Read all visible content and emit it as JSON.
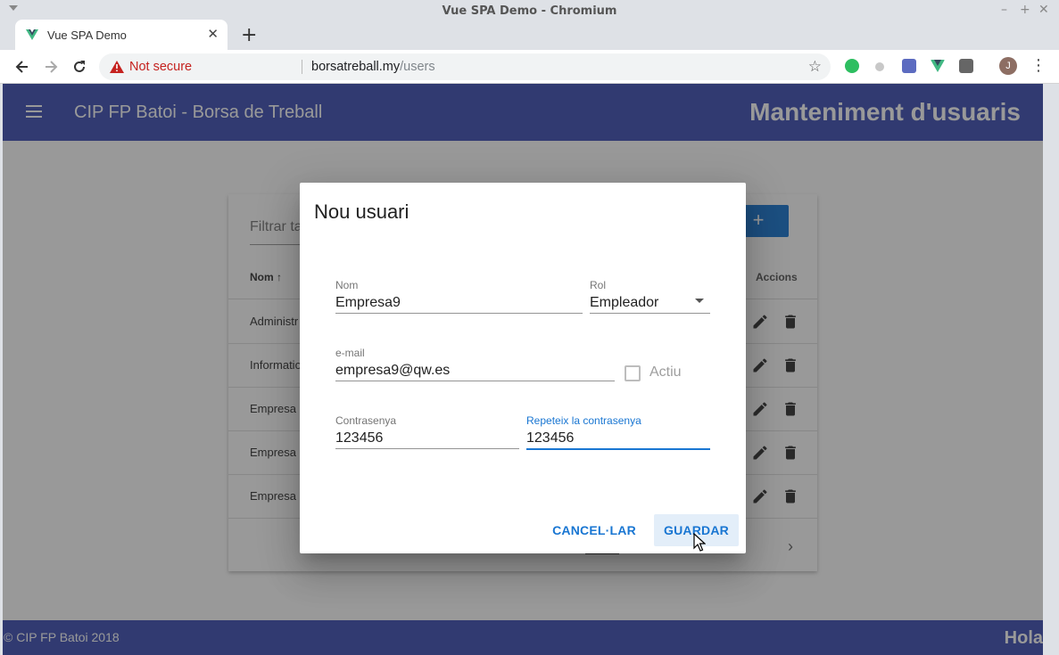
{
  "window": {
    "title": "Vue SPA Demo - Chromium",
    "controls": [
      "–",
      "+",
      "✕"
    ]
  },
  "tab": {
    "title": "Vue SPA Demo",
    "close": "✕",
    "new_tab": "+"
  },
  "address_bar": {
    "security_label": "Not secure",
    "host": "borsatreball.my",
    "path": "/users",
    "bookmark_icon": "☆"
  },
  "profile_initial": "J",
  "app": {
    "title": "CIP FP Batoi - Borsa de Treball",
    "page_heading": "Manteniment d'usuaris",
    "footer_text": "© CIP FP Batoi 2018",
    "footer_greeting": "Hola"
  },
  "table": {
    "filter_placeholder": "Filtrar ta",
    "add_label": "+",
    "col_name": "Nom",
    "sort_icon": "↑",
    "col_actions": "Accions",
    "rows": [
      "Administr",
      "Informatio",
      "Empresa p",
      "Empresa p",
      "Empresa p"
    ],
    "next_page_icon": "›"
  },
  "dialog": {
    "title": "Nou usuari",
    "fields": {
      "nom": {
        "label": "Nom",
        "value": "Empresa9"
      },
      "rol": {
        "label": "Rol",
        "value": "Empleador"
      },
      "email": {
        "label": "e-mail",
        "value": "empresa9@qw.es"
      },
      "actiu": {
        "label": "Actiu",
        "checked": false
      },
      "password": {
        "label": "Contrasenya",
        "value": "123456"
      },
      "password_repeat": {
        "label": "Repeteix la contrasenya",
        "value": "123456"
      }
    },
    "cancel_label": "CANCEL·LAR",
    "save_label": "GUARDAR"
  },
  "colors": {
    "primary": "#3f51b5",
    "accent": "#1976d2",
    "not_secure": "#c5221f"
  }
}
